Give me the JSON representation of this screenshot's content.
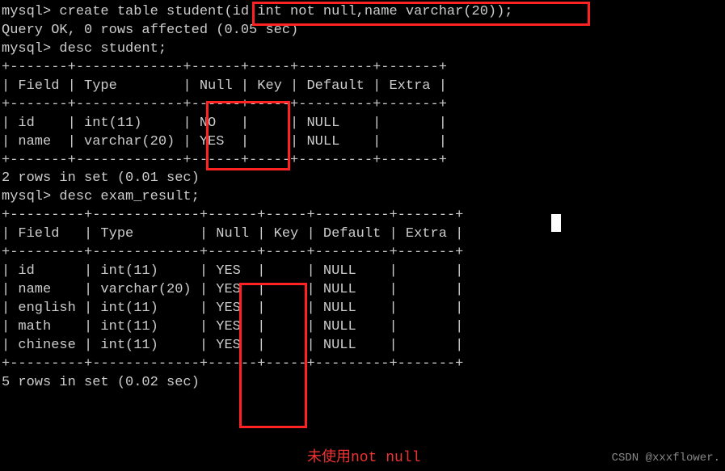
{
  "lines": {
    "l1": "mysql> create table student(id int not null,name varchar(20));",
    "l2": "Query OK, 0 rows affected (0.05 sec)",
    "l3": "",
    "l4": "mysql> desc student;",
    "l5": "+-------+-------------+------+-----+---------+-------+",
    "l6": "| Field | Type        | Null | Key | Default | Extra |",
    "l7": "+-------+-------------+------+-----+---------+-------+",
    "l8": "| id    | int(11)     | NO   |     | NULL    |       |",
    "l9": "| name  | varchar(20) | YES  |     | NULL    |       |",
    "l10": "+-------+-------------+------+-----+---------+-------+",
    "l11": "2 rows in set (0.01 sec)",
    "l12": "",
    "l13": "mysql> desc exam_result;",
    "l14": "+---------+-------------+------+-----+---------+-------+",
    "l15": "| Field   | Type        | Null | Key | Default | Extra |",
    "l16": "+---------+-------------+------+-----+---------+-------+",
    "l17": "| id      | int(11)     | YES  |     | NULL    |       |",
    "l18": "| name    | varchar(20) | YES  |     | NULL    |       |",
    "l19": "| english | int(11)     | YES  |     | NULL    |       |",
    "l20": "| math    | int(11)     | YES  |     | NULL    |       |",
    "l21": "| chinese | int(11)     | YES  |     | NULL    |       |",
    "l22": "+---------+-------------+------+-----+---------+-------+",
    "l23": "5 rows in set (0.02 sec)"
  },
  "annotation": "未使用not null",
  "watermark": "CSDN @xxxflower.",
  "chart_data": {
    "type": "table",
    "tables": [
      {
        "name": "student",
        "columns": [
          "Field",
          "Type",
          "Null",
          "Key",
          "Default",
          "Extra"
        ],
        "rows": [
          [
            "id",
            "int(11)",
            "NO",
            "",
            "NULL",
            ""
          ],
          [
            "name",
            "varchar(20)",
            "YES",
            "",
            "NULL",
            ""
          ]
        ],
        "summary": "2 rows in set (0.01 sec)"
      },
      {
        "name": "exam_result",
        "columns": [
          "Field",
          "Type",
          "Null",
          "Key",
          "Default",
          "Extra"
        ],
        "rows": [
          [
            "id",
            "int(11)",
            "YES",
            "",
            "NULL",
            ""
          ],
          [
            "name",
            "varchar(20)",
            "YES",
            "",
            "NULL",
            ""
          ],
          [
            "english",
            "int(11)",
            "YES",
            "",
            "NULL",
            ""
          ],
          [
            "math",
            "int(11)",
            "YES",
            "",
            "NULL",
            ""
          ],
          [
            "chinese",
            "int(11)",
            "YES",
            "",
            "NULL",
            ""
          ]
        ],
        "summary": "5 rows in set (0.02 sec)"
      }
    ],
    "commands": [
      "create table student(id int not null,name varchar(20));",
      "desc student;",
      "desc exam_result;"
    ]
  }
}
